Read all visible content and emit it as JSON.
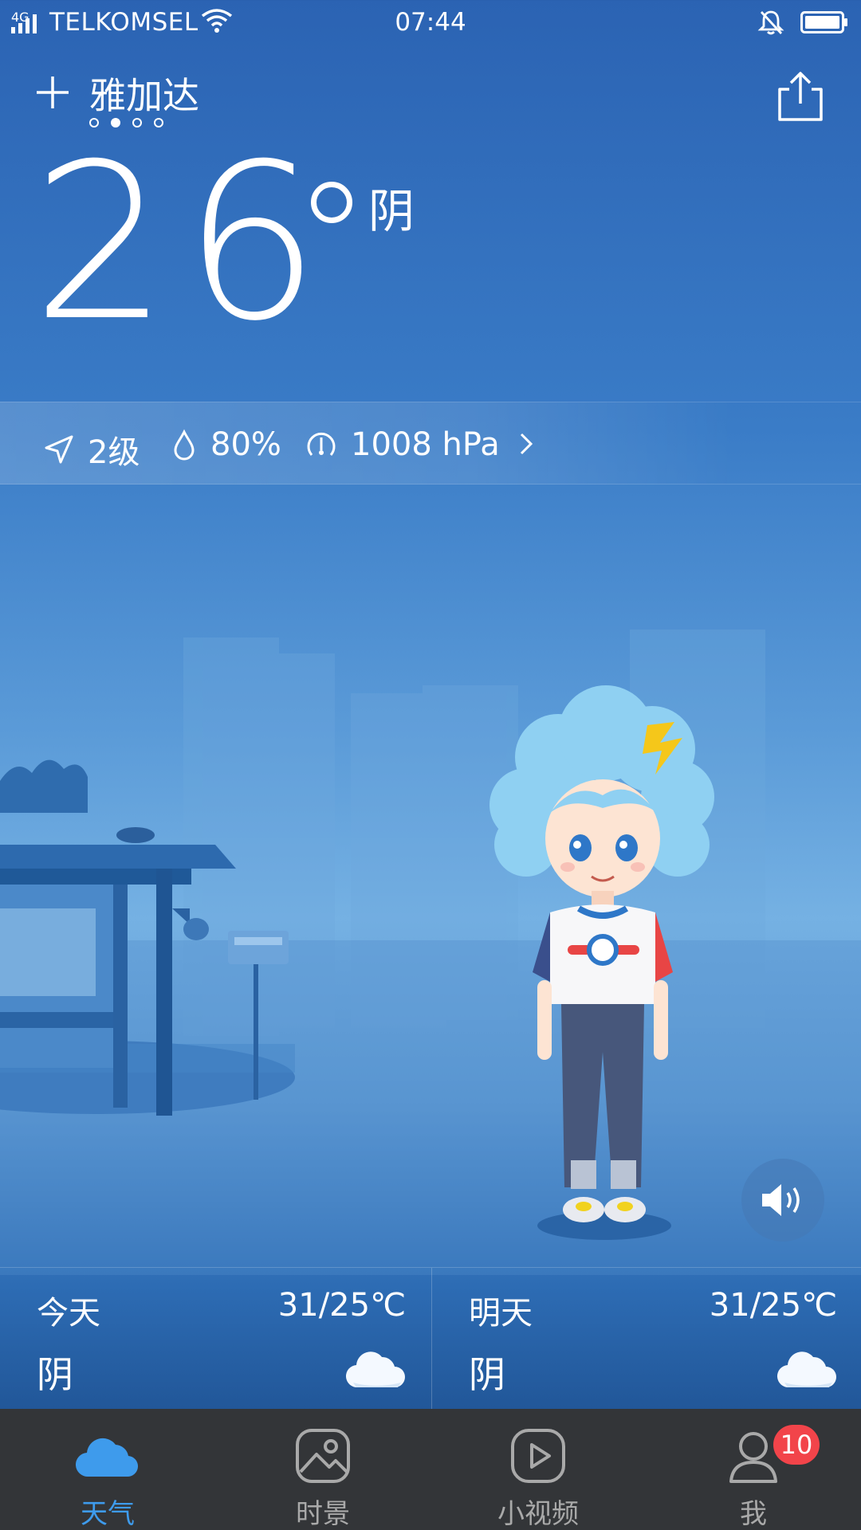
{
  "status_bar": {
    "network_type": "4G",
    "carrier": "TELKOMSEL",
    "time": "07:44",
    "icons": [
      "signal-icon",
      "wifi-icon",
      "bell-muted-icon",
      "battery-icon"
    ]
  },
  "header": {
    "add_icon": "plus-icon",
    "city": "雅加达",
    "page_count": 4,
    "active_page": 2,
    "share_icon": "share-icon"
  },
  "current": {
    "temperature": "26",
    "condition": "阴"
  },
  "details": {
    "wind": "2级",
    "humidity": "80%",
    "pressure": "1008 hPa"
  },
  "forecast": {
    "today": {
      "day": "今天",
      "range": "31/25℃",
      "condition": "阴",
      "icon": "cloud-icon"
    },
    "tomorrow": {
      "day": "明天",
      "range": "31/25℃",
      "condition": "阴",
      "icon": "cloud-icon"
    }
  },
  "nav": {
    "items": [
      {
        "label": "天气",
        "icon": "weather-cloud-icon",
        "active": true
      },
      {
        "label": "时景",
        "icon": "picture-icon",
        "active": false
      },
      {
        "label": "小视频",
        "icon": "play-icon",
        "active": false
      },
      {
        "label": "我",
        "icon": "user-icon",
        "active": false,
        "badge": "10"
      }
    ]
  },
  "colors": {
    "nav_active": "#3e9bec",
    "nav_inactive": "#a9a9a9",
    "badge": "#f2444a",
    "nav_background": "#333538"
  }
}
